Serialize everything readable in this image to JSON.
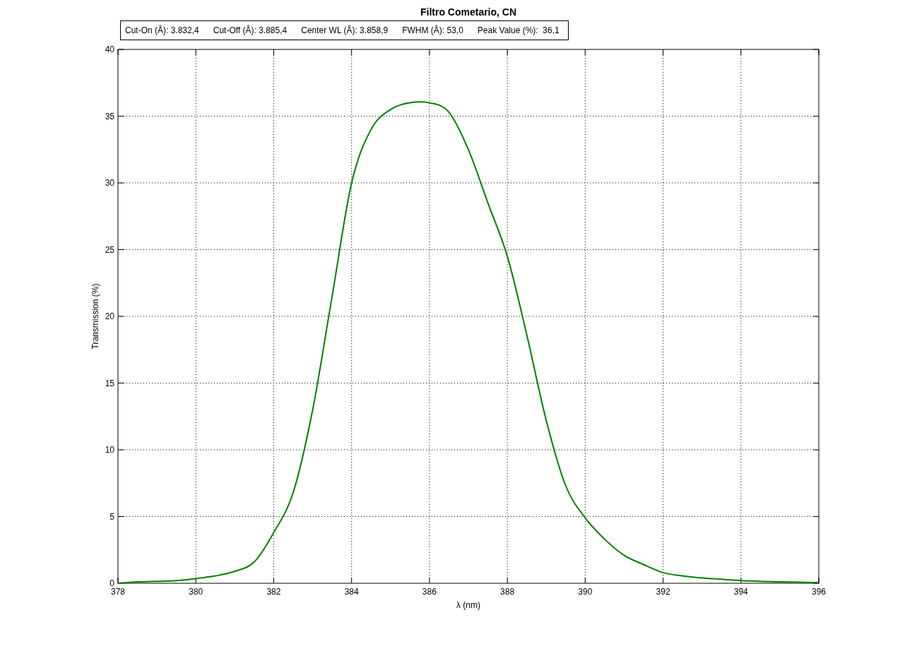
{
  "figure": {
    "stats": [
      "Cut-On (Å): 3.832,4",
      "Cut-Off (Å): 3.885,4",
      "Center WL (Å): 3.858,9",
      "FWHM (Å): 53,0",
      "Peak Value (%):  36,1"
    ],
    "chart_data": {
      "type": "line",
      "title": "Filtro Cometario, CN",
      "xlabel": "λ (nm)",
      "ylabel": "Transmission (%)",
      "x": [
        378,
        378.5,
        379,
        379.5,
        380,
        380.5,
        381,
        381.5,
        382,
        382.5,
        383,
        383.5,
        384,
        384.5,
        385,
        385.5,
        386,
        386.5,
        387,
        387.5,
        388,
        388.5,
        389,
        389.5,
        390,
        390.5,
        391,
        391.5,
        392,
        392.5,
        393,
        393.5,
        394,
        394.5,
        395,
        395.5,
        396
      ],
      "series": [
        {
          "color": "#008000",
          "values": [
            0,
            0.1,
            0.15,
            0.2,
            0.35,
            0.55,
            0.9,
            1.6,
            3.8,
            6.8,
            13,
            21.5,
            30,
            34,
            35.5,
            36,
            36,
            35.3,
            32.5,
            28.5,
            24.5,
            18.6,
            12.2,
            7.3,
            4.9,
            3.3,
            2.1,
            1.4,
            0.8,
            0.55,
            0.4,
            0.3,
            0.2,
            0.15,
            0.1,
            0.08,
            0.05
          ]
        }
      ],
      "xlim": [
        378,
        396
      ],
      "ylim": [
        0,
        40
      ],
      "xticks": [
        378,
        380,
        382,
        384,
        386,
        388,
        390,
        392,
        394,
        396
      ],
      "yticks": [
        0,
        5,
        10,
        15,
        20,
        25,
        30,
        35,
        40
      ],
      "grid": true
    }
  }
}
